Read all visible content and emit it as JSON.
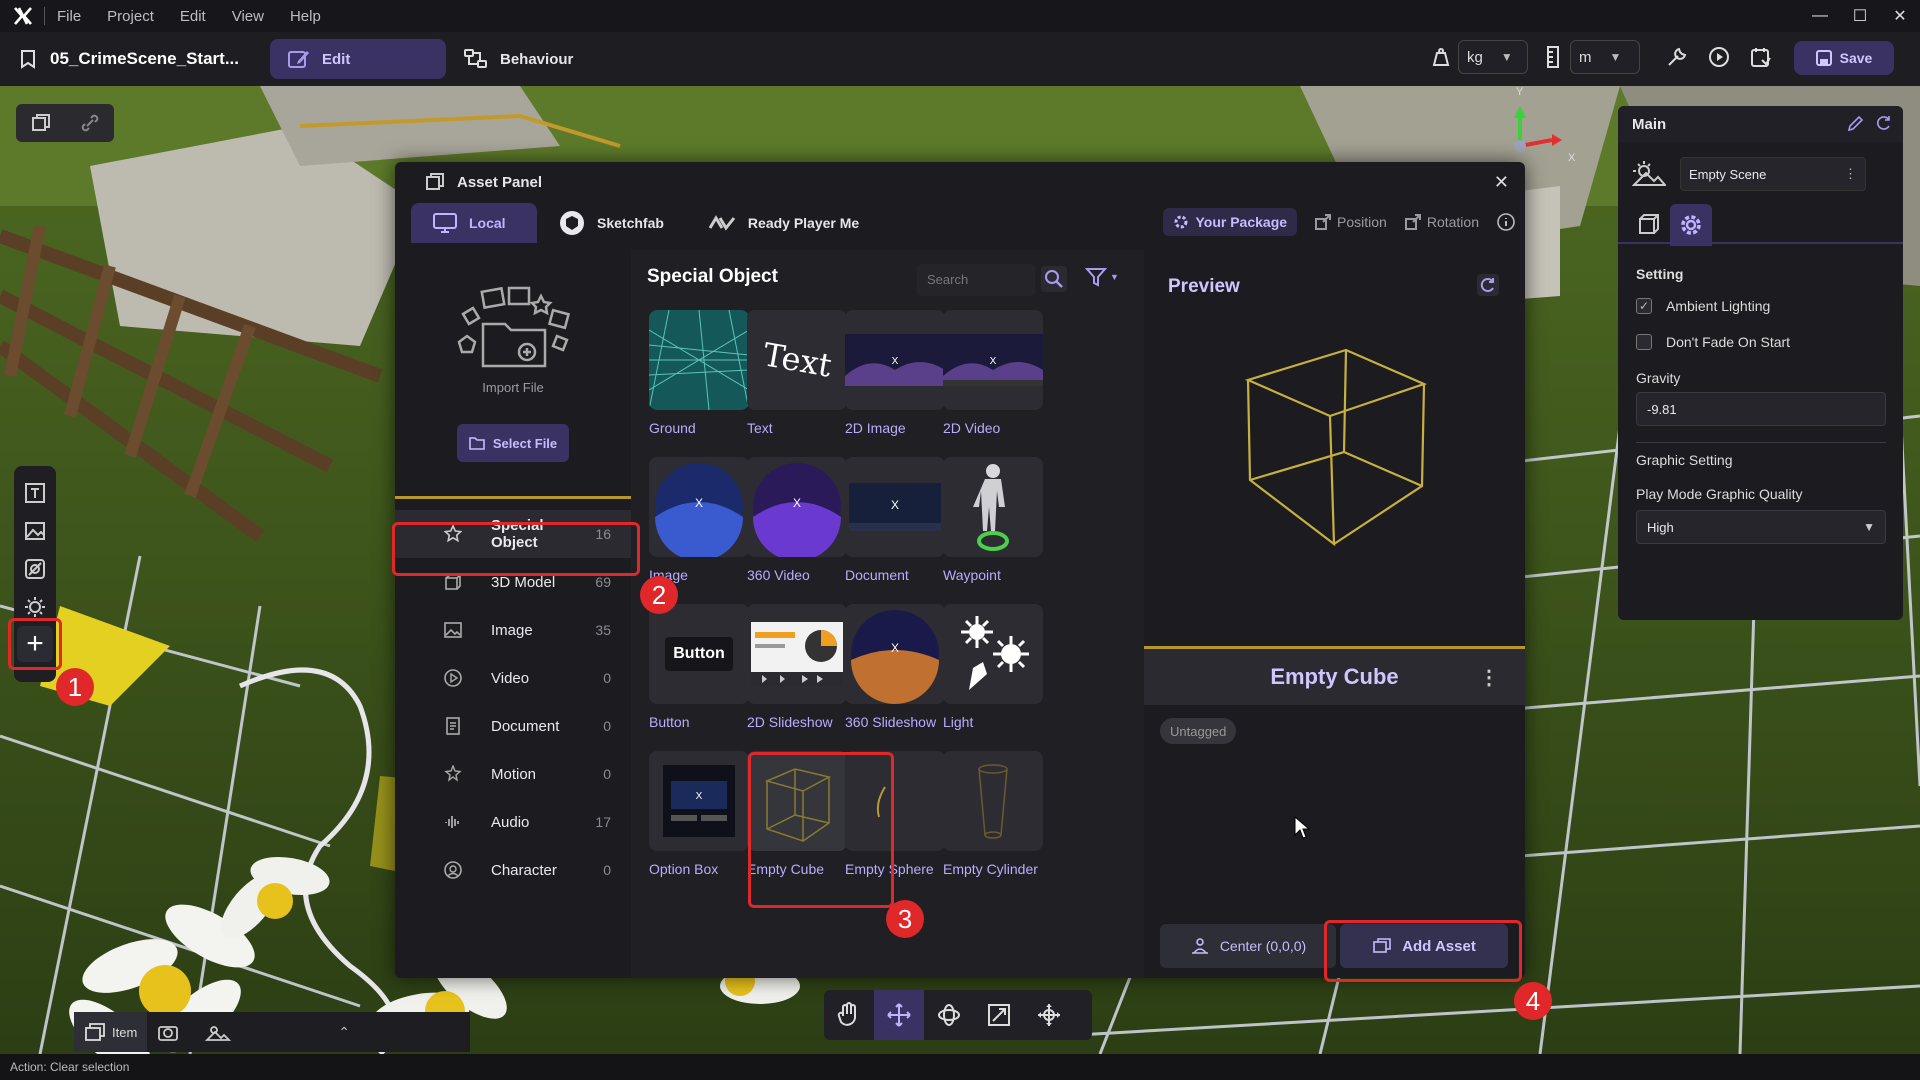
{
  "titlebar": {
    "menus": [
      "File",
      "Project",
      "Edit",
      "View",
      "Help"
    ],
    "window_controls": [
      "minimize",
      "maximize",
      "close"
    ]
  },
  "toolbar": {
    "project_name": "05_CrimeScene_Start...",
    "mode_tabs": [
      {
        "label": "Edit",
        "active": true
      },
      {
        "label": "Behaviour",
        "active": false
      }
    ],
    "mass_unit": "kg",
    "length_unit": "m",
    "save_label": "Save"
  },
  "asset_panel": {
    "title": "Asset Panel",
    "source_tabs": [
      {
        "label": "Local",
        "active": true
      },
      {
        "label": "Sketchfab",
        "active": false
      },
      {
        "label": "Ready Player Me",
        "active": false
      }
    ],
    "right_tabs": {
      "your_package": "Your Package",
      "position": "Position",
      "rotation": "Rotation"
    },
    "import_label": "Import File",
    "select_file_label": "Select File",
    "categories": [
      {
        "label": "Special Object",
        "count": "16",
        "active": true,
        "icon": "star-icon"
      },
      {
        "label": "3D Model",
        "count": "69",
        "active": false,
        "icon": "cube-icon"
      },
      {
        "label": "Image",
        "count": "35",
        "active": false,
        "icon": "image-icon"
      },
      {
        "label": "Video",
        "count": "0",
        "active": false,
        "icon": "play-circle-icon"
      },
      {
        "label": "Document",
        "count": "0",
        "active": false,
        "icon": "document-icon"
      },
      {
        "label": "Motion",
        "count": "0",
        "active": false,
        "icon": "motion-icon"
      },
      {
        "label": "Audio",
        "count": "17",
        "active": false,
        "icon": "audio-wave-icon"
      },
      {
        "label": "Character",
        "count": "0",
        "active": false,
        "icon": "character-icon"
      }
    ],
    "grid_title": "Special Object",
    "search_placeholder": "Search",
    "items": [
      {
        "label": "Ground"
      },
      {
        "label": "Text"
      },
      {
        "label": "2D Image"
      },
      {
        "label": "2D Video"
      },
      {
        "label": "Image"
      },
      {
        "label": "360 Video"
      },
      {
        "label": "Document"
      },
      {
        "label": "Waypoint"
      },
      {
        "label": "Button"
      },
      {
        "label": "2D Slideshow"
      },
      {
        "label": "360 Slideshow"
      },
      {
        "label": "Light"
      },
      {
        "label": "Option Box"
      },
      {
        "label": "Empty Cube",
        "selected": true
      },
      {
        "label": "Empty Sphere"
      },
      {
        "label": "Empty Cylinder"
      }
    ],
    "text_thumb": "Text",
    "button_thumb": "Button",
    "preview": {
      "title": "Preview",
      "name": "Empty Cube",
      "tag": "Untagged",
      "center_label": "Center (0,0,0)",
      "add_label": "Add Asset"
    }
  },
  "main_panel": {
    "title": "Main",
    "scene": "Empty Scene",
    "setting_heading": "Setting",
    "ambient_lighting": {
      "label": "Ambient Lighting",
      "checked": true
    },
    "dont_fade": {
      "label": "Don't Fade On Start",
      "checked": false
    },
    "gravity_label": "Gravity",
    "gravity_value": "-9.81",
    "graphic_setting": "Graphic Setting",
    "quality_label": "Play Mode Graphic Quality",
    "quality_value": "High"
  },
  "gizmo": {
    "y_label": "Y",
    "x_label": "X"
  },
  "bottom_tabs": {
    "item_label": "Item"
  },
  "statusbar": {
    "text": "Action: Clear selection"
  },
  "markers": [
    "1",
    "2",
    "3",
    "4"
  ],
  "colors": {
    "accent": "#3a3262",
    "accent_text": "#bfb4ff",
    "highlight": "#e0282a",
    "divider": "#b8962a"
  }
}
